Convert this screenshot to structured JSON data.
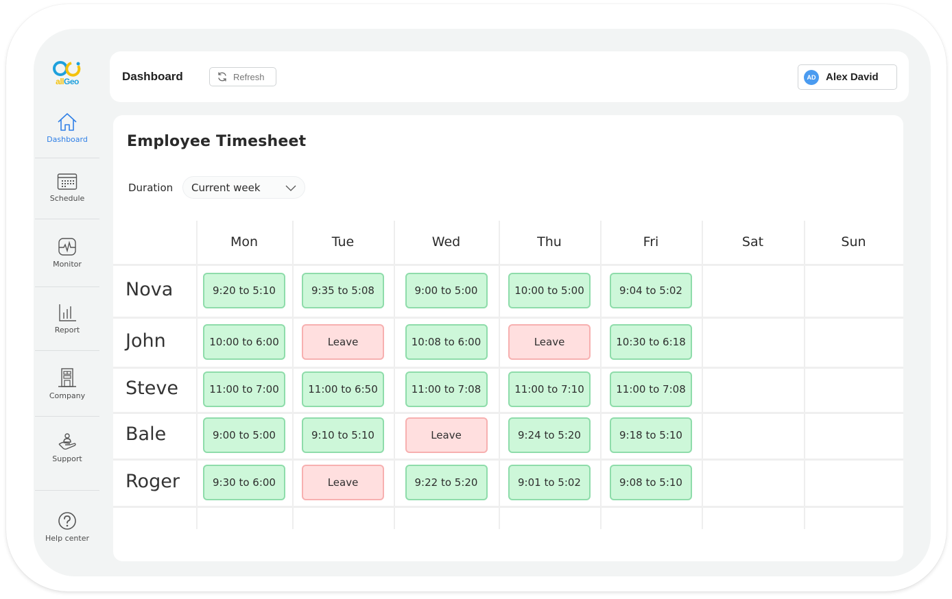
{
  "app": {
    "logo": {
      "part1": "all",
      "part2": "Geo"
    }
  },
  "sidebar": {
    "items": [
      {
        "label": "Dashboard",
        "icon": "home-icon",
        "active": true
      },
      {
        "label": "Schedule",
        "icon": "calendar-icon",
        "active": false
      },
      {
        "label": "Monitor",
        "icon": "monitor-pulse-icon",
        "active": false
      },
      {
        "label": "Report",
        "icon": "bar-chart-icon",
        "active": false
      },
      {
        "label": "Company",
        "icon": "building-icon",
        "active": false
      },
      {
        "label": "Support",
        "icon": "hand-person-icon",
        "active": false
      },
      {
        "label": "Help center",
        "icon": "help-circle-icon",
        "active": false
      }
    ]
  },
  "header": {
    "title": "Dashboard",
    "refresh_label": "Refresh",
    "user": {
      "initials": "AD",
      "name": "Alex David"
    }
  },
  "timesheet": {
    "title": "Employee Timesheet",
    "duration_label": "Duration",
    "duration_value": "Current week",
    "days": [
      "Mon",
      "Tue",
      "Wed",
      "Thu",
      "Fri",
      "Sat",
      "Sun"
    ],
    "rows": [
      {
        "name": "Nova",
        "cells": [
          "9:20 to 5:10",
          "9:35 to 5:08",
          "9:00 to 5:00",
          "10:00 to 5:00",
          "9:04 to 5:02",
          "",
          ""
        ]
      },
      {
        "name": "John",
        "cells": [
          "10:00 to 6:00",
          "Leave",
          "10:08 to 6:00",
          "Leave",
          "10:30 to 6:18",
          "",
          ""
        ]
      },
      {
        "name": "Steve",
        "cells": [
          "11:00 to 7:00",
          "11:00 to 6:50",
          "11:00 to 7:08",
          "11:00 to 7:10",
          "11:00 to 7:08",
          "",
          ""
        ]
      },
      {
        "name": "Bale",
        "cells": [
          "9:00 to 5:00",
          "9:10 to 5:10",
          "Leave",
          "9:24 to 5:20",
          "9:18 to 5:10",
          "",
          ""
        ]
      },
      {
        "name": "Roger",
        "cells": [
          "9:30 to 6:00",
          "Leave",
          "9:22 to 5:20",
          "9:01 to 5:02",
          "9:08 to 5:10",
          "",
          ""
        ]
      }
    ],
    "colors": {
      "work_bg": "#cdf7d9",
      "work_border": "#8edcaa",
      "leave_bg": "#ffdfdf",
      "leave_border": "#f7b0b0"
    }
  }
}
